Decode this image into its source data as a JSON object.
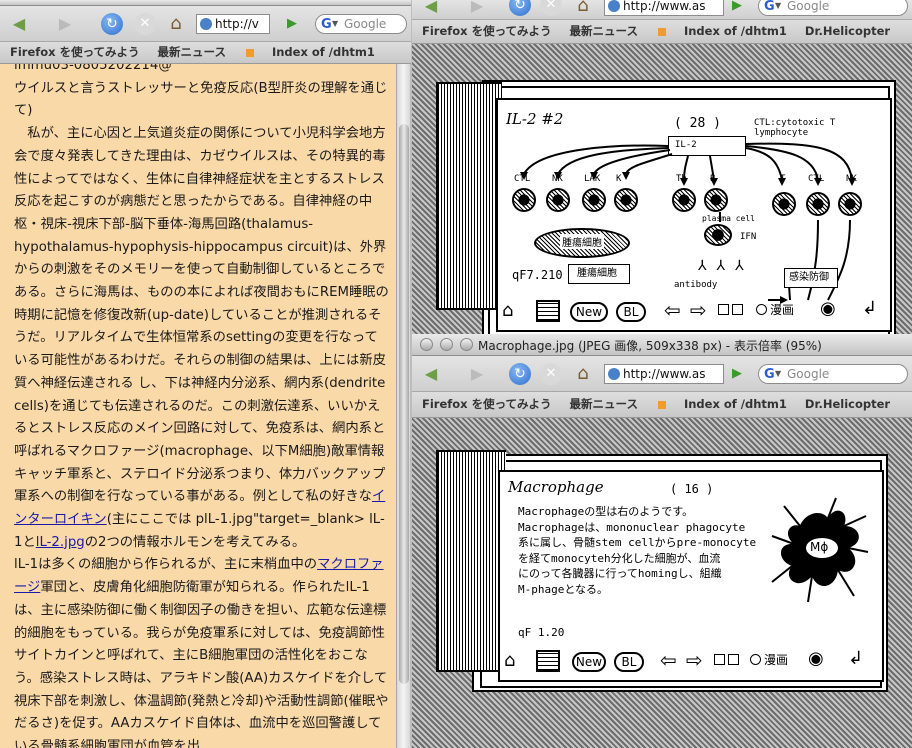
{
  "left_window": {
    "title_fragment": "immu03-0805202214@ ...",
    "url": "http://v",
    "search_placeholder": "Google",
    "bookmarks": [
      "Firefox を使ってみよう",
      "最新ニュース",
      "Index of /dhtm1"
    ],
    "content": {
      "line0": "immu03-0805202214@",
      "heading": "ウイルスと言うストレッサーと免疫反応(B型肝炎の理解を通じて)",
      "para1": "　私が、主に心因と上気道炎症の関係について小児科学会地方会で度々発表してきた理由は、カゼウイルスは、その特異的毒性によってではなく、生体に自律神経症状を主とするストレス反応を起こすのが病態だと思ったからである。自律神経の中枢・視床-視床下部-脳下垂体-海馬回路(thalamus-hypothalamus-hypophysis-hippocampus circuit)は、外界からの刺激をそのメモリーを使って自動制御しているところである。さらに海馬は、ものの本によれば夜間おもにREM睡眠の時期に記憶を修復改新(up-date)していることが推測されるそうだ。リアルタイムで生体恒常系のsettingの変更を行なっている可能性があるわけだ。それらの制御の結果は、上には新皮質へ神経伝達される し、下は神経内分泌系、網内系(dendrite cells)を通じても伝達されるのだ。この刺激伝達系、いいかえるとストレス反応のメイン回路に対して、免疫系は、網内系と呼ばれるマクロファージ(macrophage、以下M細胞)敵軍情報キャッチ軍系と、ステロイド分泌系つまり、体力バックアップ軍系への制御を行なっている事がある。例として私の好きな",
      "link1": "インターロイキン",
      "para1b": "(主にここでは plL-1.jpg\"target=_blank> lL-1と",
      "link2": "lL-2.jpg",
      "para1c": "の2つの情報ホルモンを考えてみる。",
      "para2a": "lL-1は多くの細胞から作られるが、主に末梢血中の",
      "link3": "マクロファージ",
      "para2b": "軍団と、皮膚角化細胞防衛軍が知られる。作られたlL-1は、主に感染防御に働く制御因子の働きを担い、広範な伝達標的細胞をもっている。我らが免疫軍系に対しては、免疫調節性サイトカインと呼ばれて、主にB細胞軍団の活性化をおこなう。感染ストレス時は、アラキドン酸(AA)カスケイドを介して視床下部を刺激し、体温調節(発熱と冷却)や活動性調節(催眠やだるさ)を促す。AAカスケイド自体は、血流中を巡回警護している骨髄系細胞軍団が血管を出"
    }
  },
  "top_right_window": {
    "url": "http://www.as",
    "search_placeholder": "Google",
    "bookmarks": [
      "Firefox を使ってみよう",
      "最新ニュース",
      "Index of /dhtm1",
      "Dr.Helicopter"
    ],
    "card": {
      "title": "IL-2 #2",
      "page": "( 28 )",
      "legend": "CTL:cytotoxic T lymphocyte",
      "il2_box": "IL-2",
      "cell_labels_left": [
        "CTL",
        "NK",
        "LAK",
        "K"
      ],
      "cell_labels_mid": [
        "Th",
        "B"
      ],
      "cell_labels_right": [
        "T",
        "CTL",
        "NK"
      ],
      "tumor": "腫瘍細胞",
      "plasma": "plasma cell",
      "ifn": "IFN",
      "antibody": "antibody",
      "qf": "qF7.210",
      "qf_box": "腫瘍細胞",
      "defense": "感染防御",
      "nav_new": "New",
      "nav_bl": "BL",
      "nav_manga": "漫画"
    }
  },
  "bottom_right_window": {
    "title": "Macrophage.jpg (JPEG 画像, 509x338 px) - 表示倍率 (95%)",
    "url": "http://www.as",
    "search_placeholder": "Google",
    "bookmarks": [
      "Firefox を使ってみよう",
      "最新ニュース",
      "Index of /dhtm1",
      "Dr.Helicopter"
    ],
    "card": {
      "title": "Macrophage",
      "page": "( 16 )",
      "lines": [
        "Macrophageの型は右のようです。",
        "Macrophageは、mononuclear  phagocyte",
        "系に属し、骨髄stem cellからpre-monocyte",
        "を経てmonocyteh分化した細胞が、血流",
        "にのって各臓器に行ってhomingし、組織",
        "M-phageとなる。"
      ],
      "mp_label": "Mϕ",
      "qf": "qF 1.20",
      "nav_new": "New",
      "nav_bl": "BL",
      "nav_manga": "漫画"
    }
  }
}
